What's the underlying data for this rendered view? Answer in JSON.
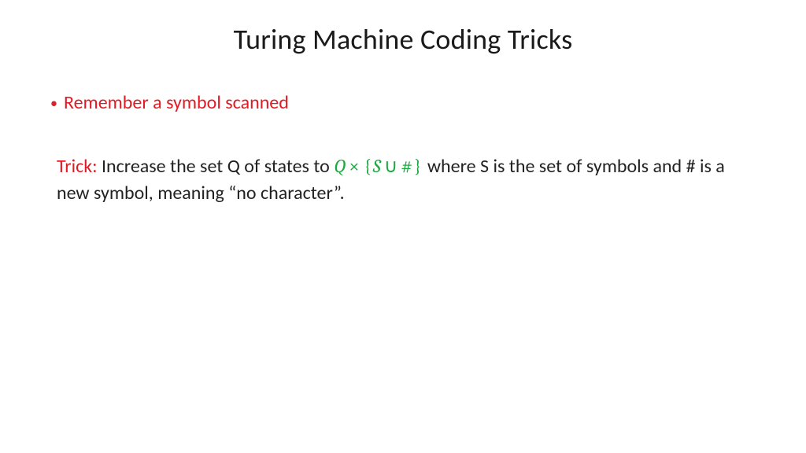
{
  "title": "Turing Machine Coding Tricks",
  "bullet": {
    "text": "Remember a symbol scanned"
  },
  "trick": {
    "label": "Trick:",
    "before_math": " Increase the set Q of states to ",
    "math": {
      "q": "Q",
      "times": "×",
      "lbrace": "{",
      "s": "S",
      "cup": "∪",
      "hash": "#",
      "rbrace": "}"
    },
    "after_math": " where S is the set of symbols and # is a new symbol, meaning “no character”."
  }
}
